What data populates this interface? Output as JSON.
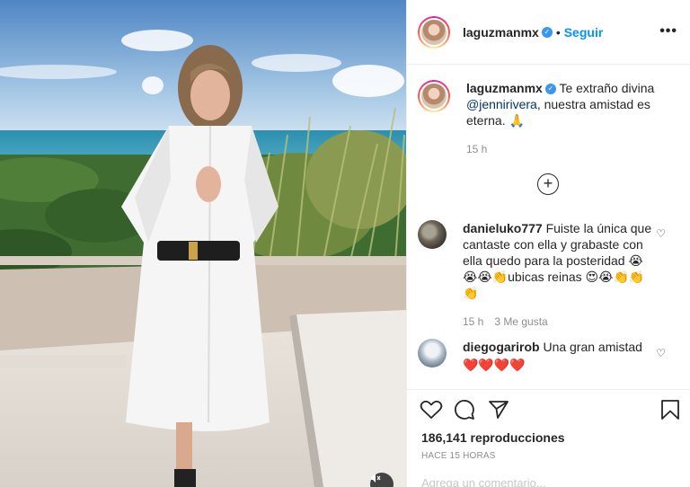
{
  "post": {
    "username": "laguzmanmx",
    "follow_label": "Seguir",
    "separator": "•"
  },
  "caption": {
    "username": "laguzmanmx",
    "text_before": "Te extraño divina ",
    "mention": "@jennirivera",
    "text_after": ", nuestra amistad es eterna. 🙏",
    "time": "15 h"
  },
  "comments": [
    {
      "username": "danieluko777",
      "text": "Fuiste la única que cantaste con ella y grabaste con ella quedo para la posteridad 😭😭😭👏ubicas reinas 😍😭👏👏👏",
      "time": "15 h",
      "likes": "3 Me gusta"
    },
    {
      "username": "diegogarirob",
      "text": "Una gran amistad",
      "emojis": "❤️❤️❤️❤️"
    }
  ],
  "stats": {
    "views": "186,141 reproducciones",
    "posted": "HACE 15 HORAS"
  },
  "add_comment_placeholder": "Agrega un comentario...",
  "icons": {
    "verified": "verified-badge-icon",
    "more": "more-options-icon",
    "load_more": "plus-circle-icon",
    "like": "heart-outline-icon",
    "comment": "comment-bubble-icon",
    "share": "paper-plane-icon",
    "save": "bookmark-icon",
    "mute": "speaker-muted-icon"
  },
  "colors": {
    "accent": "#0095f6",
    "verified": "#3897f0",
    "muted_text": "#8e8e8e",
    "text": "#262626",
    "border": "#efefef"
  }
}
